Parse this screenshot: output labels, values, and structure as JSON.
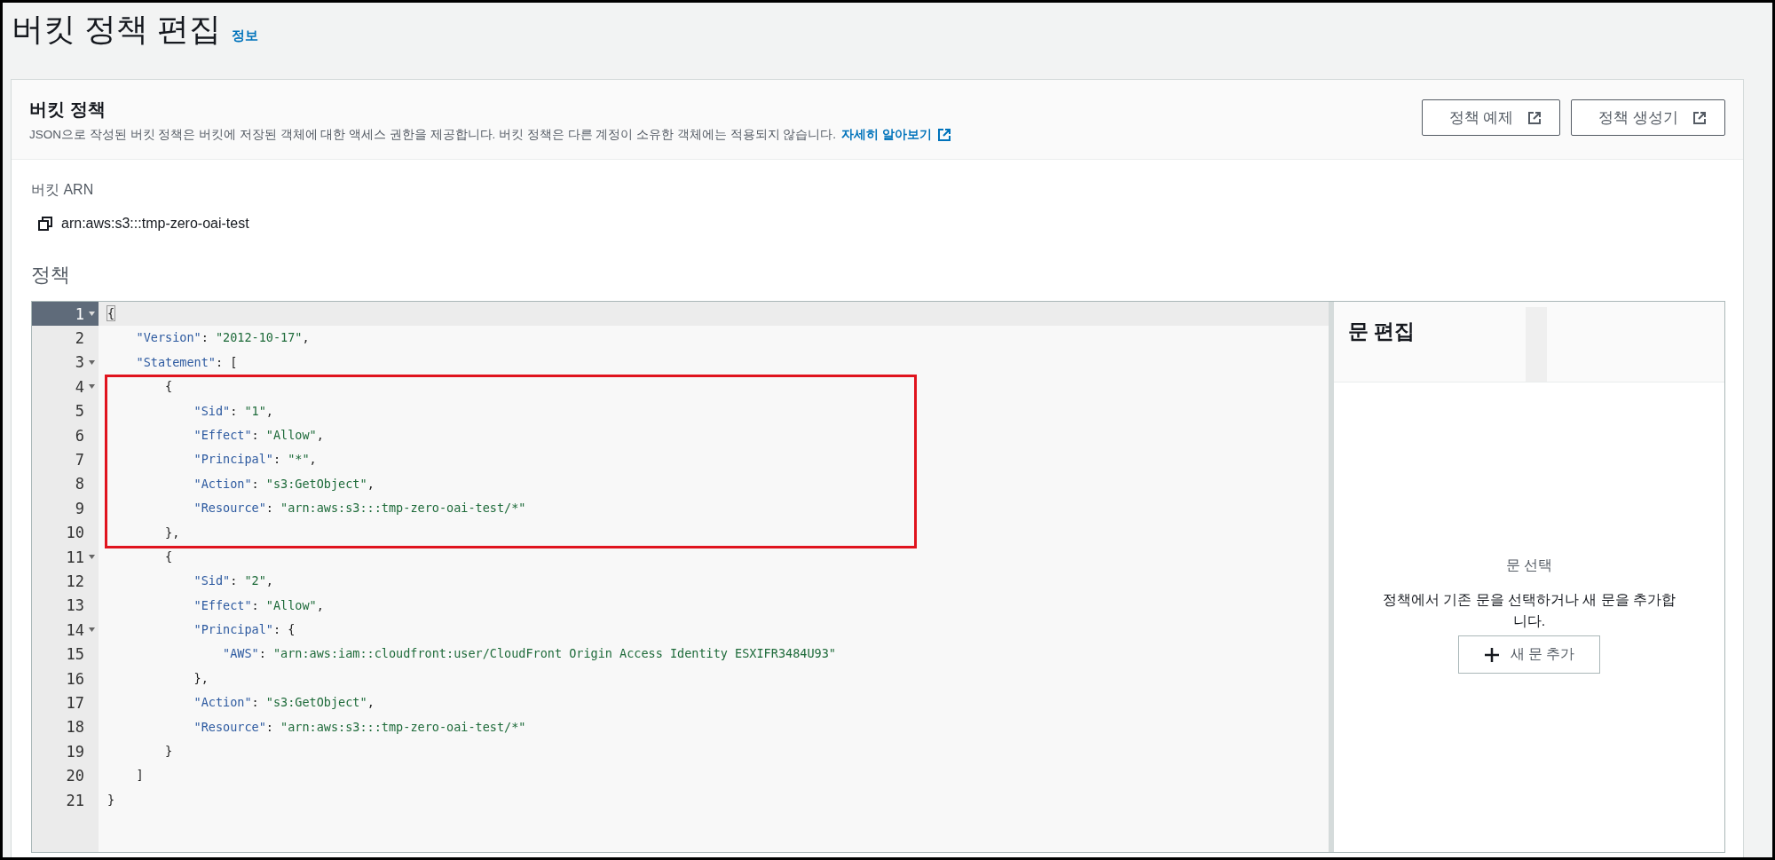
{
  "page": {
    "title": "버킷 정책 편집",
    "info_link": "정보"
  },
  "card": {
    "title": "버킷 정책",
    "description": "JSON으로 작성된 버킷 정책은 버킷에 저장된 객체에 대한 액세스 권한을 제공합니다. 버킷 정책은 다른 계정이 소유한 객체에는 적용되지 않습니다.",
    "learn_more": "자세히 알아보기",
    "buttons": [
      "정책 예제",
      "정책 생성기"
    ]
  },
  "arn": {
    "label": "버킷 ARN",
    "value": "arn:aws:s3:::tmp-zero-oai-test"
  },
  "policy_label": "정책",
  "editor": {
    "lines": [
      {
        "kind": "line",
        "number": "1",
        "text": "{",
        "foldable": true,
        "selected": true
      },
      {
        "kind": "line",
        "number": "2",
        "text": "\"Version\": \"2012-10-17\",",
        "foldable": false,
        "selected": false
      },
      {
        "kind": "line",
        "number": "3",
        "text": "\"Statement\": [",
        "foldable": true,
        "selected": false
      },
      {
        "kind": "highlight",
        "lines": [
          {
            "kind": "line",
            "number": "4",
            "text": "{",
            "foldable": true,
            "selected": false
          },
          {
            "kind": "line",
            "number": "5",
            "text": "\"Sid\": \"1\",",
            "foldable": false,
            "selected": false
          },
          {
            "kind": "line",
            "number": "6",
            "text": "\"Effect\": \"Allow\",",
            "foldable": false,
            "selected": false
          },
          {
            "kind": "line",
            "number": "7",
            "text": "\"Principal\": \"*\",",
            "foldable": false,
            "selected": false
          },
          {
            "kind": "line",
            "number": "8",
            "text": "\"Action\": \"s3:GetObject\",",
            "foldable": false,
            "selected": false
          },
          {
            "kind": "line",
            "number": "9",
            "text": "\"Resource\": \"arn:aws:s3:::tmp-zero-oai-test/*\"",
            "foldable": false,
            "selected": false
          },
          {
            "kind": "line",
            "number": "10",
            "text": "},",
            "foldable": false,
            "selected": false
          }
        ]
      },
      {
        "kind": "line",
        "number": "11",
        "text": "{",
        "foldable": true,
        "selected": false
      },
      {
        "kind": "line",
        "number": "12",
        "text": "\"Sid\": \"2\",",
        "foldable": false,
        "selected": false
      },
      {
        "kind": "line",
        "number": "13",
        "text": "\"Effect\": \"Allow\",",
        "foldable": false,
        "selected": false
      },
      {
        "kind": "line",
        "number": "14",
        "text": "\"Principal\": {",
        "foldable": true,
        "selected": false
      },
      {
        "kind": "line",
        "number": "15",
        "text": "\"AWS\": \"arn:aws:iam::cloudfront:user/CloudFront Origin Access Identity ESXIFR3484U93\"",
        "foldable": false,
        "selected": false
      },
      {
        "kind": "line",
        "number": "16",
        "text": "},",
        "foldable": false,
        "selected": false
      },
      {
        "kind": "line",
        "number": "17",
        "text": "\"Action\": \"s3:GetObject\",",
        "foldable": false,
        "selected": false
      },
      {
        "kind": "line",
        "number": "18",
        "text": "\"Resource\": \"arn:aws:s3:::tmp-zero-oai-test/*\"",
        "foldable": false,
        "selected": false
      },
      {
        "kind": "line",
        "number": "19",
        "text": "}",
        "foldable": false,
        "selected": false
      },
      {
        "kind": "line",
        "number": "20",
        "text": "]",
        "foldable": false,
        "selected": false
      },
      {
        "kind": "line",
        "number": "21",
        "text": "}",
        "foldable": false,
        "selected": false
      }
    ]
  },
  "statement_panel": {
    "title": "문 편집",
    "empty_title": "문 선택",
    "empty_text": "정책에서 기존 문을 선택하거나 새 문을 추가합니다.",
    "add_button": "새 문 추가"
  }
}
